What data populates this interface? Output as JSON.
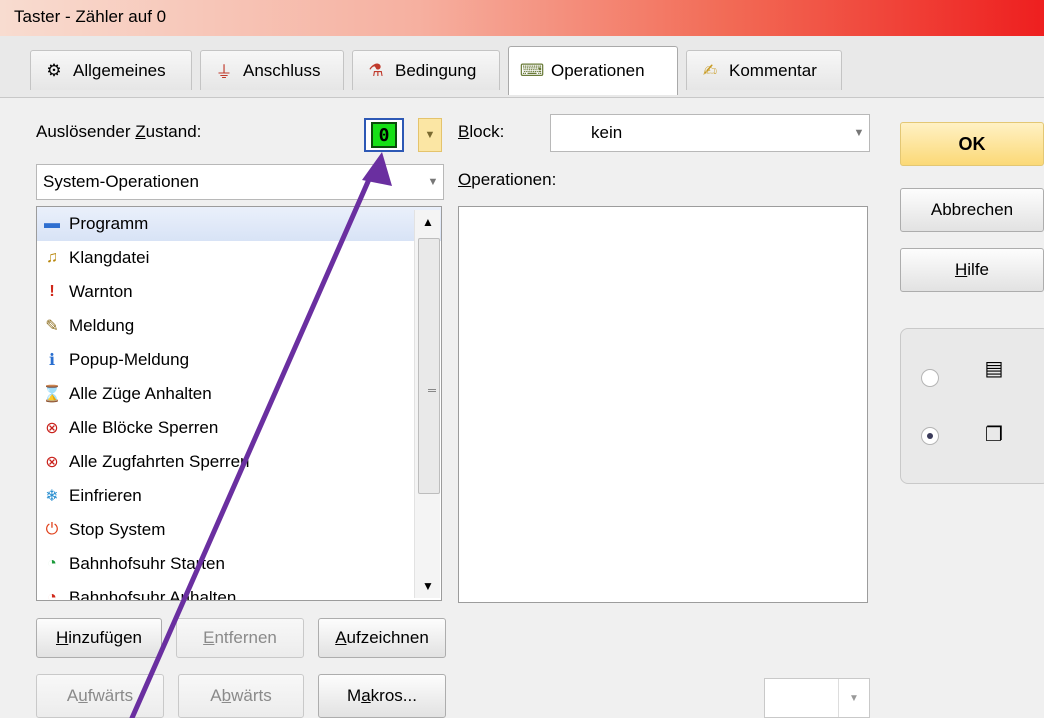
{
  "window": {
    "title": "Taster - Zähler auf 0"
  },
  "tabs": [
    {
      "label": "Allgemeines",
      "icon": "settings-icon"
    },
    {
      "label": "Anschluss",
      "icon": "plug-icon"
    },
    {
      "label": "Bedingung",
      "icon": "condition-icon"
    },
    {
      "label": "Operationen",
      "icon": "operations-icon",
      "active": true
    },
    {
      "label": "Kommentar",
      "icon": "comment-icon"
    }
  ],
  "trigger": {
    "label_pre": "Auslösender ",
    "label_ul": "Z",
    "label_post": "ustand:",
    "value": "0"
  },
  "block": {
    "label_ul": "B",
    "label_post": "lock:",
    "value": "kein"
  },
  "category": {
    "value": "System-Operationen"
  },
  "operations_label": {
    "ul": "O",
    "post": "perationen:"
  },
  "oplist": [
    {
      "label": "Programm",
      "icon": "computer-icon",
      "selected": true
    },
    {
      "label": "Klangdatei",
      "icon": "sound-file-icon"
    },
    {
      "label": "Warnton",
      "icon": "alert-icon"
    },
    {
      "label": "Meldung",
      "icon": "pencil-icon"
    },
    {
      "label": "Popup-Meldung",
      "icon": "info-icon"
    },
    {
      "label": "Alle Züge Anhalten",
      "icon": "hourglass-icon"
    },
    {
      "label": "Alle Blöcke Sperren",
      "icon": "block-lock-icon"
    },
    {
      "label": "Alle Zugfahrten Sperren",
      "icon": "route-lock-icon"
    },
    {
      "label": "Einfrieren",
      "icon": "freeze-icon"
    },
    {
      "label": "Stop System",
      "icon": "stop-icon"
    },
    {
      "label": "Bahnhofsuhr Starten",
      "icon": "clock-icon"
    },
    {
      "label": "Bahnhofsuhr Anhalten",
      "icon": "clock-stop-icon"
    }
  ],
  "buttons": {
    "add": {
      "ul": "H",
      "post": "inzufügen"
    },
    "remove": {
      "ul": "E",
      "post": "ntfernen"
    },
    "record": {
      "ul": "A",
      "post": "ufzeichnen"
    },
    "up": {
      "pre": "A",
      "ul": "u",
      "post": "fwärts"
    },
    "down": {
      "pre": "A",
      "ul": "b",
      "post": "wärts"
    },
    "macros": {
      "pre": "M",
      "ul": "a",
      "post": "kros..."
    },
    "ok": "OK",
    "cancel": "Abbrechen",
    "help": {
      "ul": "H",
      "post": "ilfe"
    }
  },
  "view_options": [
    {
      "icon": "list-view-icon",
      "selected": false
    },
    {
      "icon": "window-view-icon",
      "selected": true
    }
  ],
  "colors": {
    "accent": "#6a2fa0",
    "lcd": "#16e016",
    "ok": "#fbd977"
  }
}
